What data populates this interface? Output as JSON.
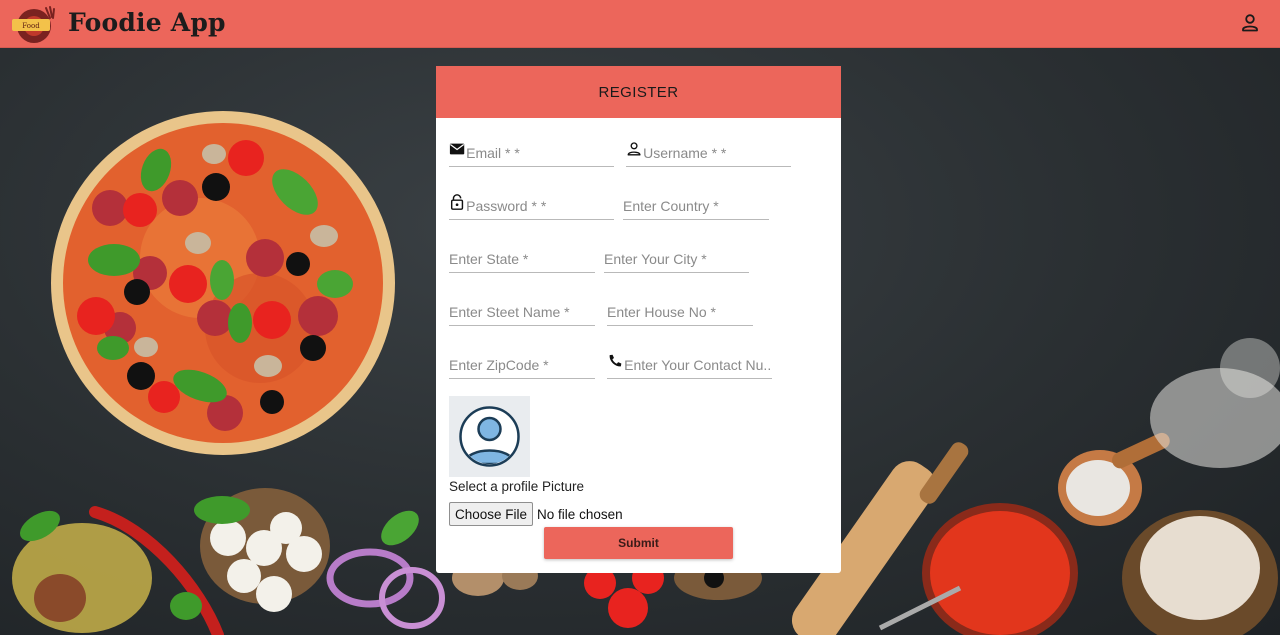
{
  "navbar": {
    "brand": "Foodie App",
    "logo_badge": "Food",
    "account_icon": "person-outline-icon"
  },
  "form": {
    "title": "REGISTER",
    "fields": {
      "email": {
        "placeholder": "Email * *",
        "icon": "envelope-icon"
      },
      "username": {
        "placeholder": "Username * *",
        "icon": "person-icon"
      },
      "password": {
        "placeholder": "Password * *",
        "icon": "lock-open-icon"
      },
      "country": {
        "placeholder": "Enter Country *"
      },
      "state": {
        "placeholder": "Enter State *"
      },
      "city": {
        "placeholder": "Enter Your City *"
      },
      "street": {
        "placeholder": "Enter Steet Name *"
      },
      "house": {
        "placeholder": "Enter House No *"
      },
      "zipcode": {
        "placeholder": "Enter ZipCode *"
      },
      "contact": {
        "placeholder": "Enter Your Contact Nu...",
        "icon": "phone-icon"
      }
    },
    "profile_picture_label": "Select a profile Picture",
    "choose_file_label": "Choose File",
    "no_file_text": "No file chosen",
    "submit_label": "Submit"
  },
  "colors": {
    "accent": "#ec665b",
    "background": "#2b3033",
    "card": "#ffffff"
  }
}
